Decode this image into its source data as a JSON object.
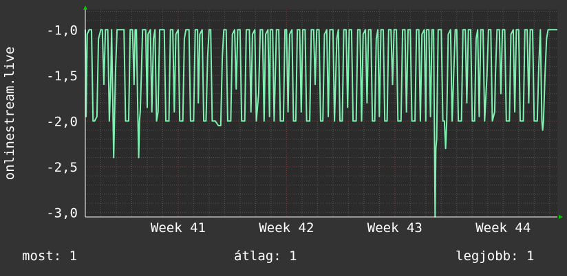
{
  "chart_data": {
    "type": "line",
    "ylabel": "onlinestream.live",
    "ylim": [
      -3.05,
      -0.78
    ],
    "y_ticks": [
      {
        "value": -1.0,
        "label": "-1,0"
      },
      {
        "value": -1.5,
        "label": "-1,5"
      },
      {
        "value": -2.0,
        "label": "-2,0"
      },
      {
        "value": -2.5,
        "label": "-2,5"
      },
      {
        "value": -3.0,
        "label": "-3,0"
      }
    ],
    "x_range": [
      0,
      30.5
    ],
    "x_unit": "days",
    "x_ticks": [
      {
        "value": 6.0,
        "label": "Week 41"
      },
      {
        "value": 13.0,
        "label": "Week 42"
      },
      {
        "value": 20.0,
        "label": "Week 43"
      },
      {
        "value": 27.0,
        "label": "Week 44"
      }
    ],
    "grid": true,
    "line_color": "#7ff2b2",
    "series": [
      {
        "values": [
          [
            0.0,
            -1.0
          ],
          [
            0.05,
            -1.95
          ],
          [
            0.12,
            -1.05
          ],
          [
            0.25,
            -1.0
          ],
          [
            0.4,
            -1.0
          ],
          [
            0.5,
            -2.0
          ],
          [
            0.6,
            -2.0
          ],
          [
            0.75,
            -1.95
          ],
          [
            0.85,
            -1.1
          ],
          [
            1.0,
            -1.0
          ],
          [
            1.1,
            -1.0
          ],
          [
            1.2,
            -1.6
          ],
          [
            1.3,
            -1.0
          ],
          [
            1.45,
            -1.0
          ],
          [
            1.55,
            -2.0
          ],
          [
            1.65,
            -1.5
          ],
          [
            1.7,
            -1.0
          ],
          [
            1.8,
            -2.05
          ],
          [
            1.83,
            -2.4
          ],
          [
            1.88,
            -2.0
          ],
          [
            1.95,
            -1.45
          ],
          [
            2.05,
            -1.0
          ],
          [
            2.5,
            -1.0
          ],
          [
            2.6,
            -2.0
          ],
          [
            2.8,
            -2.0
          ],
          [
            2.9,
            -1.0
          ],
          [
            3.05,
            -1.0
          ],
          [
            3.15,
            -1.6
          ],
          [
            3.22,
            -1.0
          ],
          [
            3.3,
            -1.0
          ],
          [
            3.4,
            -2.0
          ],
          [
            3.45,
            -2.4
          ],
          [
            3.5,
            -2.0
          ],
          [
            3.55,
            -1.9
          ],
          [
            3.62,
            -1.5
          ],
          [
            3.7,
            -1.0
          ],
          [
            3.9,
            -1.0
          ],
          [
            4.0,
            -1.85
          ],
          [
            4.05,
            -1.05
          ],
          [
            4.2,
            -1.0
          ],
          [
            4.3,
            -1.9
          ],
          [
            4.4,
            -1.1
          ],
          [
            4.5,
            -1.0
          ],
          [
            4.6,
            -2.0
          ],
          [
            4.7,
            -1.9
          ],
          [
            4.8,
            -1.0
          ],
          [
            5.1,
            -1.0
          ],
          [
            5.2,
            -2.0
          ],
          [
            5.4,
            -2.0
          ],
          [
            5.5,
            -1.0
          ],
          [
            5.65,
            -1.0
          ],
          [
            5.75,
            -1.9
          ],
          [
            5.85,
            -1.05
          ],
          [
            6.0,
            -1.0
          ],
          [
            6.1,
            -2.0
          ],
          [
            6.3,
            -2.0
          ],
          [
            6.4,
            -1.1
          ],
          [
            6.5,
            -1.0
          ],
          [
            6.7,
            -1.0
          ],
          [
            6.8,
            -2.0
          ],
          [
            7.0,
            -2.0
          ],
          [
            7.1,
            -1.0
          ],
          [
            7.25,
            -1.0
          ],
          [
            7.3,
            -1.8
          ],
          [
            7.4,
            -1.05
          ],
          [
            7.55,
            -1.0
          ],
          [
            7.65,
            -2.0
          ],
          [
            7.8,
            -2.0
          ],
          [
            7.9,
            -1.3
          ],
          [
            8.0,
            -1.0
          ],
          [
            8.1,
            -1.0
          ],
          [
            8.2,
            -2.0
          ],
          [
            8.4,
            -2.0
          ],
          [
            8.6,
            -2.05
          ],
          [
            8.75,
            -2.05
          ],
          [
            8.85,
            -1.3
          ],
          [
            8.95,
            -1.0
          ],
          [
            9.1,
            -1.0
          ],
          [
            9.2,
            -2.0
          ],
          [
            9.4,
            -2.0
          ],
          [
            9.5,
            -1.05
          ],
          [
            9.65,
            -1.0
          ],
          [
            9.75,
            -1.65
          ],
          [
            9.85,
            -1.0
          ],
          [
            10.0,
            -1.0
          ],
          [
            10.1,
            -2.0
          ],
          [
            10.3,
            -2.0
          ],
          [
            10.4,
            -1.0
          ],
          [
            10.6,
            -1.0
          ],
          [
            10.7,
            -1.9
          ],
          [
            10.8,
            -1.05
          ],
          [
            10.95,
            -1.0
          ],
          [
            11.05,
            -2.0
          ],
          [
            11.2,
            -1.7
          ],
          [
            11.3,
            -1.0
          ],
          [
            11.45,
            -1.0
          ],
          [
            11.55,
            -2.0
          ],
          [
            11.65,
            -1.05
          ],
          [
            11.8,
            -1.0
          ],
          [
            11.9,
            -1.95
          ],
          [
            11.95,
            -1.0
          ],
          [
            12.1,
            -1.0
          ],
          [
            12.2,
            -2.0
          ],
          [
            12.35,
            -1.0
          ],
          [
            12.5,
            -1.0
          ],
          [
            12.6,
            -2.0
          ],
          [
            12.8,
            -2.0
          ],
          [
            12.9,
            -1.0
          ],
          [
            13.0,
            -1.0
          ],
          [
            13.1,
            -1.9
          ],
          [
            13.2,
            -1.05
          ],
          [
            13.35,
            -1.0
          ],
          [
            13.45,
            -2.0
          ],
          [
            13.6,
            -2.0
          ],
          [
            13.7,
            -1.0
          ],
          [
            13.85,
            -1.0
          ],
          [
            13.95,
            -1.9
          ],
          [
            14.05,
            -1.0
          ],
          [
            14.2,
            -1.0
          ],
          [
            14.3,
            -2.0
          ],
          [
            14.5,
            -2.0
          ],
          [
            14.6,
            -1.0
          ],
          [
            14.75,
            -1.0
          ],
          [
            14.85,
            -1.6
          ],
          [
            14.95,
            -1.0
          ],
          [
            15.1,
            -1.0
          ],
          [
            15.2,
            -2.0
          ],
          [
            15.35,
            -2.0
          ],
          [
            15.45,
            -1.05
          ],
          [
            15.6,
            -1.0
          ],
          [
            15.7,
            -1.95
          ],
          [
            15.8,
            -1.0
          ],
          [
            16.0,
            -1.0
          ],
          [
            16.1,
            -2.0
          ],
          [
            16.25,
            -1.1
          ],
          [
            16.35,
            -1.0
          ],
          [
            16.45,
            -2.0
          ],
          [
            16.6,
            -2.0
          ],
          [
            16.7,
            -1.0
          ],
          [
            16.85,
            -1.0
          ],
          [
            16.95,
            -1.85
          ],
          [
            17.05,
            -1.0
          ],
          [
            17.2,
            -1.0
          ],
          [
            17.3,
            -2.0
          ],
          [
            17.5,
            -2.0
          ],
          [
            17.6,
            -1.0
          ],
          [
            17.75,
            -1.0
          ],
          [
            17.85,
            -2.0
          ],
          [
            17.95,
            -1.05
          ],
          [
            18.1,
            -1.0
          ],
          [
            18.2,
            -1.8
          ],
          [
            18.3,
            -1.0
          ],
          [
            18.45,
            -1.0
          ],
          [
            18.55,
            -2.0
          ],
          [
            18.7,
            -2.0
          ],
          [
            18.8,
            -1.1
          ],
          [
            18.9,
            -1.0
          ],
          [
            19.0,
            -1.95
          ],
          [
            19.1,
            -1.0
          ],
          [
            19.25,
            -1.0
          ],
          [
            19.35,
            -2.0
          ],
          [
            19.5,
            -2.0
          ],
          [
            19.6,
            -1.0
          ],
          [
            19.75,
            -1.0
          ],
          [
            19.85,
            -1.6
          ],
          [
            19.95,
            -1.0
          ],
          [
            20.1,
            -1.0
          ],
          [
            20.2,
            -2.0
          ],
          [
            20.4,
            -2.0
          ],
          [
            20.5,
            -1.0
          ],
          [
            20.65,
            -1.0
          ],
          [
            20.75,
            -1.9
          ],
          [
            20.85,
            -1.0
          ],
          [
            21.0,
            -1.0
          ],
          [
            21.1,
            -2.0
          ],
          [
            21.3,
            -2.0
          ],
          [
            21.4,
            -1.0
          ],
          [
            21.55,
            -1.0
          ],
          [
            21.65,
            -2.0
          ],
          [
            21.75,
            -1.05
          ],
          [
            21.9,
            -1.0
          ],
          [
            22.0,
            -2.0
          ],
          [
            22.05,
            -1.0
          ],
          [
            22.2,
            -1.0
          ],
          [
            22.3,
            -1.95
          ],
          [
            22.4,
            -1.0
          ],
          [
            22.5,
            -1.0
          ],
          [
            22.55,
            -2.0
          ],
          [
            22.6,
            -3.05
          ],
          [
            22.65,
            -2.3
          ],
          [
            22.7,
            -2.2
          ],
          [
            22.8,
            -1.0
          ],
          [
            23.0,
            -1.0
          ],
          [
            23.1,
            -2.0
          ],
          [
            23.2,
            -2.0
          ],
          [
            23.28,
            -2.3
          ],
          [
            23.35,
            -2.0
          ],
          [
            23.45,
            -1.05
          ],
          [
            23.6,
            -1.0
          ],
          [
            23.7,
            -2.0
          ],
          [
            23.8,
            -1.5
          ],
          [
            23.9,
            -1.0
          ],
          [
            24.0,
            -1.0
          ],
          [
            24.1,
            -2.0
          ],
          [
            24.3,
            -2.0
          ],
          [
            24.4,
            -1.0
          ],
          [
            24.55,
            -1.0
          ],
          [
            24.65,
            -1.8
          ],
          [
            24.75,
            -1.0
          ],
          [
            24.9,
            -1.0
          ],
          [
            25.0,
            -2.0
          ],
          [
            25.15,
            -2.0
          ],
          [
            25.25,
            -1.1
          ],
          [
            25.35,
            -1.0
          ],
          [
            25.45,
            -1.95
          ],
          [
            25.55,
            -1.0
          ],
          [
            25.7,
            -1.0
          ],
          [
            25.8,
            -2.0
          ],
          [
            25.95,
            -1.5
          ],
          [
            26.05,
            -1.0
          ],
          [
            26.2,
            -1.0
          ],
          [
            26.3,
            -2.0
          ],
          [
            26.45,
            -1.9
          ],
          [
            26.5,
            -1.5
          ],
          [
            26.6,
            -1.0
          ],
          [
            26.75,
            -1.0
          ],
          [
            26.85,
            -1.7
          ],
          [
            26.95,
            -1.0
          ],
          [
            27.1,
            -1.0
          ],
          [
            27.2,
            -2.0
          ],
          [
            27.4,
            -2.0
          ],
          [
            27.5,
            -1.05
          ],
          [
            27.65,
            -1.0
          ],
          [
            27.75,
            -1.9
          ],
          [
            27.85,
            -1.0
          ],
          [
            28.0,
            -1.0
          ],
          [
            28.1,
            -2.0
          ],
          [
            28.3,
            -2.0
          ],
          [
            28.4,
            -1.0
          ],
          [
            28.55,
            -1.0
          ],
          [
            28.65,
            -1.8
          ],
          [
            28.75,
            -1.0
          ],
          [
            28.9,
            -1.0
          ],
          [
            29.0,
            -2.0
          ],
          [
            29.2,
            -2.0
          ],
          [
            29.3,
            -1.4
          ],
          [
            29.4,
            -1.0
          ],
          [
            29.5,
            -2.0
          ],
          [
            29.55,
            -2.1
          ],
          [
            29.6,
            -2.0
          ],
          [
            29.7,
            -1.5
          ],
          [
            29.8,
            -1.1
          ],
          [
            29.9,
            -1.0
          ],
          [
            30.5,
            -1.0
          ]
        ]
      }
    ]
  },
  "footer": {
    "current": "most: 1",
    "average": "átlag: 1",
    "best": "legjobb: 1"
  }
}
